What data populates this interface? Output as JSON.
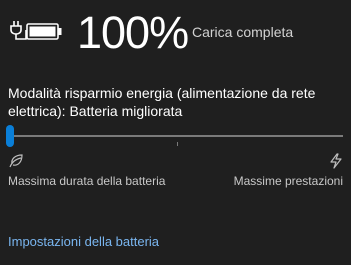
{
  "battery": {
    "icon": "battery-plugged-icon",
    "percent_text": "100%",
    "charge_fraction": 1.0,
    "status": "Carica completa"
  },
  "power_mode": {
    "label": "Modalità risparmio energia (alimentazione da rete elettrica): Batteria migliorata",
    "slider_position": 0,
    "slider_max": 3,
    "min_icon": "leaf-icon",
    "max_icon": "lightning-bolt-icon",
    "min_label": "Massima durata della batteria",
    "max_label": "Massime prestazioni"
  },
  "settings_link": "Impostazioni della batteria",
  "colors": {
    "background": "#1f1f1f",
    "accent": "#0a7fd8",
    "link": "#7ab6f0"
  }
}
